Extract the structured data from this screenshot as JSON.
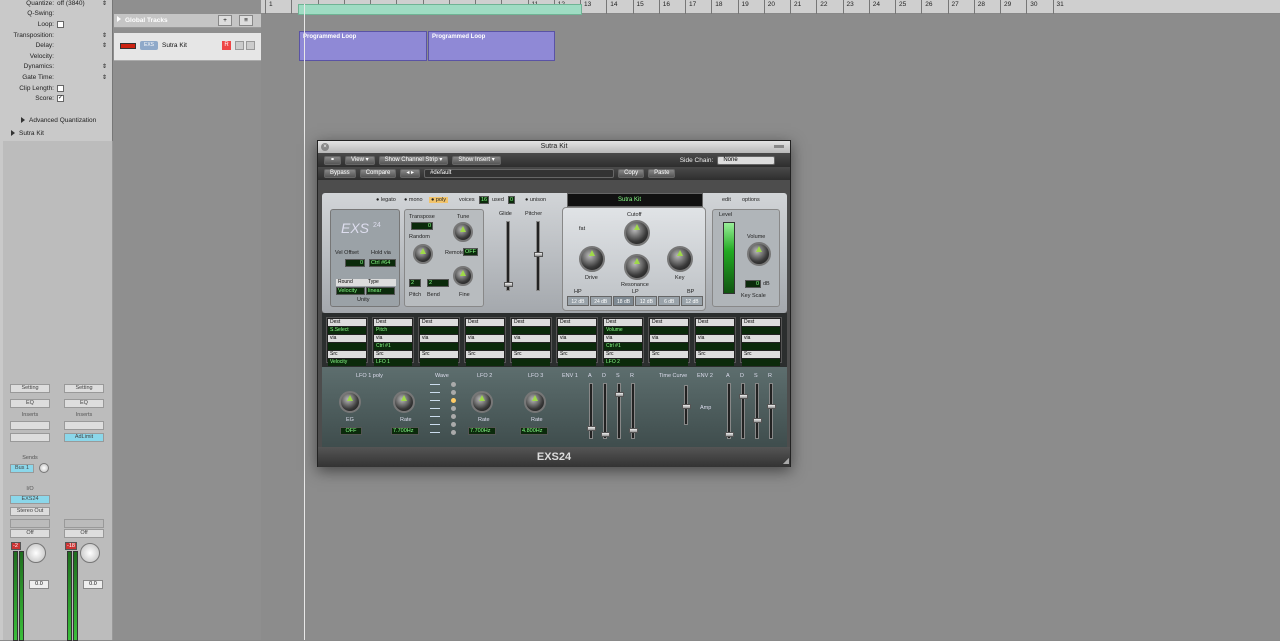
{
  "inspector": {
    "params": [
      {
        "label": "Quantize:",
        "value": "off (3840)",
        "kind": "select"
      },
      {
        "label": "Q-Swing:",
        "value": "",
        "kind": "text"
      },
      {
        "label": "Loop:",
        "value": "",
        "kind": "check",
        "checked": false
      },
      {
        "label": "Transposition:",
        "value": "",
        "kind": "select"
      },
      {
        "label": "Delay:",
        "value": "",
        "kind": "select"
      },
      {
        "label": "Velocity:",
        "value": "",
        "kind": "text"
      },
      {
        "label": "Dynamics:",
        "value": "",
        "kind": "select"
      },
      {
        "label": "Gate Time:",
        "value": "",
        "kind": "select"
      },
      {
        "label": "Clip Length:",
        "value": "",
        "kind": "check",
        "checked": false
      },
      {
        "label": "Score:",
        "value": "",
        "kind": "check",
        "checked": true
      }
    ],
    "advanced_quant": "Advanced Quantization",
    "track_section": "Sutra Kit"
  },
  "strip1": {
    "setting": "Setting",
    "eq": "EQ",
    "inserts": "Inserts",
    "sends": "Sends",
    "bus": "Bus 1",
    "io": "I/O",
    "instrument": "EXS24",
    "output": "Stereo Out",
    "automation": "Off",
    "level": "0.0",
    "peak": "-2"
  },
  "strip2": {
    "setting": "Setting",
    "eq": "EQ",
    "inserts": "Inserts",
    "insert1": "AdLimit",
    "automation": "Off",
    "level": "0.0",
    "peak": "-18"
  },
  "tracks": {
    "global": "Global Tracks",
    "track_name": "Sutra Kit",
    "track_icon": "EXS"
  },
  "ruler": [
    "1",
    "",
    "",
    "",
    "",
    "",
    "",
    "",
    "",
    "",
    "11",
    "12",
    "13",
    "14",
    "15",
    "16",
    "17",
    "18",
    "19",
    "20",
    "21",
    "22",
    "23",
    "24",
    "25",
    "26",
    "27",
    "28",
    "29",
    "30",
    "31"
  ],
  "regions": [
    {
      "name": "Programmed Loop"
    },
    {
      "name": "Programmed Loop"
    }
  ],
  "plugin": {
    "title": "Sutra Kit",
    "view": "View",
    "show_strip": "Show Channel Strip",
    "show_insert": "Show Insert",
    "sidechain_label": "Side Chain:",
    "sidechain": "None",
    "bypass": "Bypass",
    "compare": "Compare",
    "preset": "#default",
    "copy": "Copy",
    "paste": "Paste",
    "footer": "EXS24",
    "modes": {
      "legato": "legato",
      "mono": "mono",
      "poly": "poly",
      "voices_label": "voices",
      "voices": "16",
      "used_label": "used",
      "used": "0",
      "unison": "unison"
    },
    "instrument_name": "Sutra Kit",
    "edit": "edit",
    "options": "options",
    "logo": "EXS",
    "logo_ver": "24",
    "vel_offset": "Vel Offset",
    "hold_via": "Hold via",
    "vel_val": "0",
    "hold_val": "Ctrl #64",
    "r_select": "Round",
    "r_type": "Type",
    "r_via": "Velocity",
    "r_lin": "linear",
    "r_label": "Unity",
    "transpose": "Transpose",
    "tune": "Tune",
    "transpose_val": "0",
    "random": "Random",
    "remote": "Remote",
    "remote_val": "OFF",
    "pitch": "Pitch",
    "bend": "Bend",
    "fine": "Fine",
    "pitch_val": "2",
    "bend_val": "2",
    "glide": "Glide",
    "pitcher": "Pitcher",
    "cutoff": "Cutoff",
    "drive": "Drive",
    "resonance": "Resonance",
    "key": "Key",
    "filter_modes": [
      "12 dB",
      "24 dB",
      "18 dB",
      "12 dB",
      "6 dB",
      "12 dB"
    ],
    "fat": "fat",
    "hp": "HP",
    "lp": "LP",
    "bp": "BP",
    "level": "Level",
    "volume": "Volume",
    "key_scale": "Key Scale",
    "key_scale_val": "0",
    "db": "dB",
    "mod_slots": [
      {
        "dest": "Dest",
        "d2": "S.Select",
        "via": "via",
        "src": "Src",
        "s2": "Velocity"
      },
      {
        "dest": "Dest",
        "d2": "Pitch",
        "via": "via",
        "v2": "Ctrl #1",
        "src": "Src",
        "s2": "LFO 1"
      },
      {
        "dest": "Dest",
        "via": "via",
        "src": "Src"
      },
      {
        "dest": "Dest",
        "via": "via",
        "src": "Src"
      },
      {
        "dest": "Dest",
        "via": "via",
        "src": "Src"
      },
      {
        "dest": "Dest",
        "via": "via",
        "src": "Src"
      },
      {
        "dest": "Dest",
        "d2": "Volume",
        "via": "via",
        "v2": "Ctrl #1",
        "src": "Src",
        "s2": "LFO 2"
      },
      {
        "dest": "Dest",
        "via": "via",
        "src": "Src"
      },
      {
        "dest": "Dest",
        "via": "via",
        "src": "Src"
      },
      {
        "dest": "Dest",
        "via": "via",
        "src": "Src"
      }
    ],
    "lfo1": "LFO 1 poly",
    "lfo_eg": "EG",
    "lfo_eg_val": "OFF",
    "rate": "Rate",
    "lfo1_rate": "7.700Hz",
    "wave": "Wave",
    "lfo2": "LFO 2",
    "lfo2_rate": "7.700Hz",
    "lfo3": "LFO 3",
    "lfo3_rate": "4.800Hz",
    "env1": "ENV 1",
    "env2": "ENV 2",
    "adsr": [
      "A",
      "D",
      "S",
      "R"
    ],
    "time_curve": "Time Curve",
    "amp": "Amp"
  }
}
